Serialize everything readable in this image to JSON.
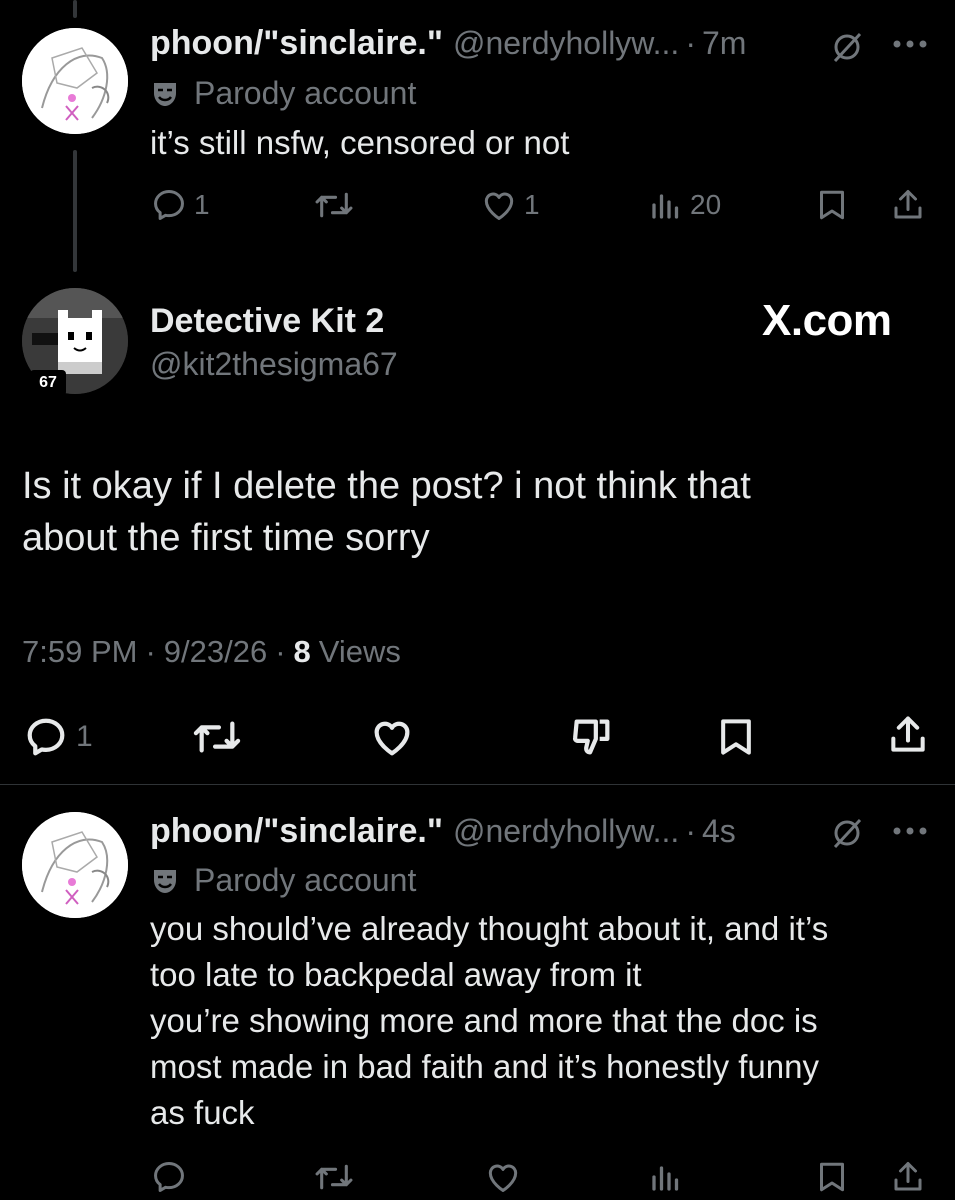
{
  "reply1": {
    "name": "phoon/\"sinclaire.\"",
    "handle": "@nerdyhollyw...",
    "sep": "·",
    "time": "7m",
    "badge": "Parody account",
    "text": "it’s still nsfw, censored or not",
    "replies": "1",
    "likes": "1",
    "views": "20"
  },
  "main_post": {
    "name": "Detective Kit 2",
    "handle": "@kit2thesigma67",
    "avatar_badge": "67",
    "brand": "X.com",
    "text_line1": "Is it okay if I delete the post? i not think that",
    "text_line2": "about the first time sorry",
    "time": "7:59 PM",
    "date": "9/23/26",
    "sep": "·",
    "views_count": "8",
    "views_label": "Views",
    "replies": "1"
  },
  "reply2": {
    "name": "phoon/\"sinclaire.\"",
    "handle": "@nerdyhollyw...",
    "sep": "·",
    "time": "4s",
    "badge": "Parody account",
    "lines": [
      "you should’ve already thought about it, and it’s",
      "too late to backpedal away from it",
      "you’re showing more and more that the doc is",
      "most made in bad faith and it’s honestly funny",
      "as fuck"
    ]
  },
  "colors": {
    "background": "#000000",
    "text": "#e7e9ea",
    "muted": "#71767b",
    "divider": "#2f3336"
  }
}
